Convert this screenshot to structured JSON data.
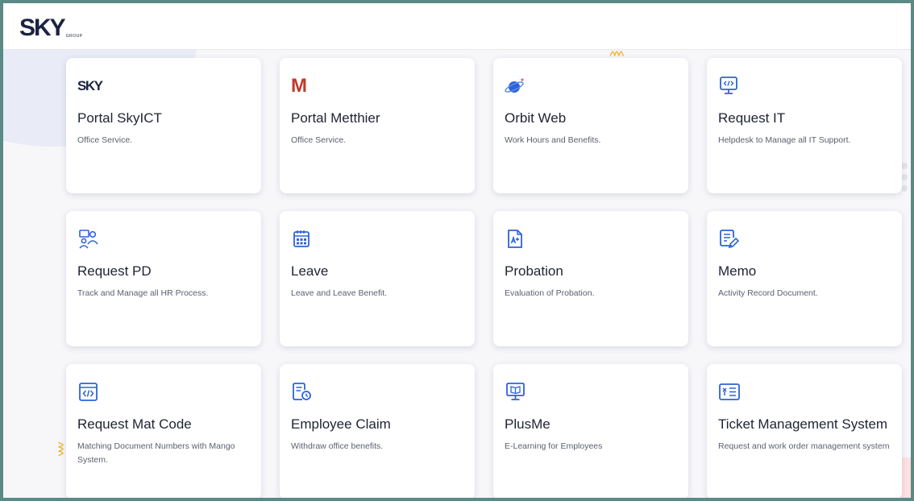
{
  "header": {
    "logo_text": "SKY",
    "logo_sub": "GROUP"
  },
  "colors": {
    "accent": "#2d63d8",
    "title": "#1f2333",
    "desc": "#5c6070",
    "frame": "#5b8a86"
  },
  "cards": [
    {
      "title": "Portal SkyICT",
      "desc": "Office Service.",
      "icon": "sky-logo-icon",
      "icon_text": "SKY"
    },
    {
      "title": "Portal Metthier",
      "desc": "Office Service.",
      "icon": "metthier-logo-icon",
      "icon_text": "M"
    },
    {
      "title": "Orbit Web",
      "desc": "Work Hours and Benefits.",
      "icon": "orbit-planet-icon"
    },
    {
      "title": "Request IT",
      "desc": "Helpdesk to Manage all IT Support.",
      "icon": "monitor-code-icon"
    },
    {
      "title": "Request PD",
      "desc": "Track and Manage all HR Process.",
      "icon": "hr-people-icon"
    },
    {
      "title": "Leave",
      "desc": "Leave and Leave Benefit.",
      "icon": "calendar-icon"
    },
    {
      "title": "Probation",
      "desc": "Evaluation of Probation.",
      "icon": "document-grade-icon"
    },
    {
      "title": "Memo",
      "desc": "Activity Record Document.",
      "icon": "memo-edit-icon"
    },
    {
      "title": "Request Mat Code",
      "desc": "Matching Document Numbers with Mango System.",
      "icon": "code-window-icon"
    },
    {
      "title": "Employee Claim",
      "desc": "Withdraw office benefits.",
      "icon": "claim-document-icon"
    },
    {
      "title": "PlusMe",
      "desc": "E-Learning for Employees",
      "icon": "elearning-monitor-icon"
    },
    {
      "title": "Ticket Management System",
      "desc": "Request and work order management system",
      "icon": "ticket-tools-icon"
    }
  ]
}
